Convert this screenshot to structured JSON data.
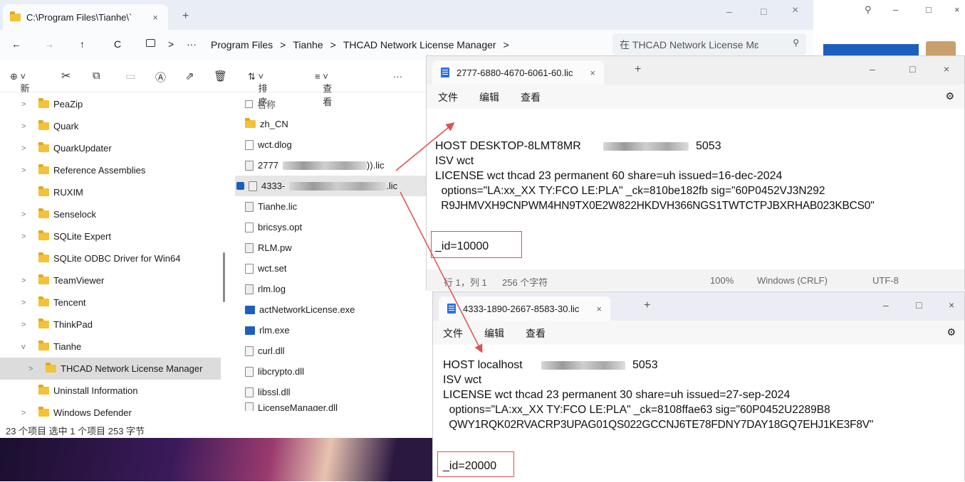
{
  "explorer": {
    "tab_title": "C:\\Program Files\\Tianhe\\`",
    "tab_close": "×",
    "new_tab": "+",
    "nav_back": "←",
    "nav_forward": "→",
    "nav_up": "↑",
    "nav_refresh": "C",
    "breadcrumb": [
      "Program Files",
      "Tianhe",
      "THCAD Network License Manager"
    ],
    "breadcrumb_sep": ">",
    "breadcrumb_more": "···",
    "search_placeholder": "在 THCAD Network License Mɛ",
    "toolbar": {
      "new": "新建",
      "sort": "排序",
      "view": "查看",
      "more": "···"
    },
    "tree": [
      {
        "label": "PeaZip",
        "expand": ">"
      },
      {
        "label": "Quark",
        "expand": ">"
      },
      {
        "label": "QuarkUpdater",
        "expand": ">"
      },
      {
        "label": "Reference Assemblies",
        "expand": ">"
      },
      {
        "label": "RUXIM",
        "expand": ""
      },
      {
        "label": "Senselock",
        "expand": ">"
      },
      {
        "label": "SQLite Expert",
        "expand": ">"
      },
      {
        "label": "SQLite ODBC Driver for Win64",
        "expand": ""
      },
      {
        "label": "TeamViewer",
        "expand": ">"
      },
      {
        "label": "Tencent",
        "expand": ">"
      },
      {
        "label": "ThinkPad",
        "expand": ">"
      },
      {
        "label": "Tianhe",
        "expand": "v"
      },
      {
        "label": "THCAD Network License Manager",
        "expand": ">"
      },
      {
        "label": "Uninstall Information",
        "expand": ""
      },
      {
        "label": "Windows Defender",
        "expand": ">"
      }
    ],
    "files_header": "名称",
    "files": [
      {
        "name": "zh_CN",
        "type": "folder"
      },
      {
        "name": "wct.dlog",
        "type": "file"
      },
      {
        "name": "2777",
        "suffix": ")).lic",
        "type": "lic"
      },
      {
        "name": "4333-",
        "suffix": ".lic",
        "type": "lic"
      },
      {
        "name": "Tianhe.lic",
        "type": "lic"
      },
      {
        "name": "bricsys.opt",
        "type": "file"
      },
      {
        "name": "RLM.pw",
        "type": "lic"
      },
      {
        "name": "wct.set",
        "type": "file"
      },
      {
        "name": "rlm.log",
        "type": "lic"
      },
      {
        "name": "actNetworkLicense.exe",
        "type": "app"
      },
      {
        "name": "rlm.exe",
        "type": "app"
      },
      {
        "name": "curl.dll",
        "type": "dll"
      },
      {
        "name": "libcrypto.dll",
        "type": "dll"
      },
      {
        "name": "libssl.dll",
        "type": "dll"
      },
      {
        "name": "LicenseManager.dll",
        "type": "dll"
      }
    ],
    "status": "23 个项目    选中 1 个项目  253 字节"
  },
  "notepad1": {
    "tab_title": "2777-6880-4670-6061-60.lic",
    "menu": [
      "文件",
      "编辑",
      "查看"
    ],
    "lines": [
      "HOST DESKTOP-8LMT8MR",
      "5053",
      "ISV wct",
      "LICENSE wct thcad 23 permanent 60 share=uh issued=16-dec-2024",
      "  options=\"LA:xx_XX TY:FCO LE:PLA\" _ck=810be182fb sig=\"60P0452VJ3N292",
      "  R9JHMVXH9CNPWM4HN9TX0E2W822HKDVH366NGS1TWTCTPJBXRHAB023KBCS0\"",
      "_id=10000"
    ],
    "status": {
      "pos": "行 1，列 1",
      "chars": "256 个字符",
      "zoom": "100%",
      "eol": "Windows (CRLF)",
      "enc": "UTF-8"
    }
  },
  "notepad2": {
    "tab_title": "4333-1890-2667-8583-30.lic",
    "menu": [
      "文件",
      "编辑",
      "查看"
    ],
    "lines": [
      "HOST localhost",
      "5053",
      "ISV wct",
      "LICENSE wct thcad 23 permanent 30 share=uh issued=27-sep-2024",
      "  options=\"LA:xx_XX TY:FCO LE:PLA\" _ck=8108ffae63 sig=\"60P0452U2289B8",
      "  QWY1RQK02RVACRP3UPAG01QS022GCCNJ6TE78FDNY7DAY18GQ7EHJ1KE3F8V\"",
      "_id=20000"
    ]
  },
  "window_controls": {
    "minimize": "–",
    "maximize": "□",
    "close": "×"
  },
  "colors": {
    "folder": "#f2c33a",
    "annotation": "#e05050",
    "accent": "#1c5fbf"
  }
}
